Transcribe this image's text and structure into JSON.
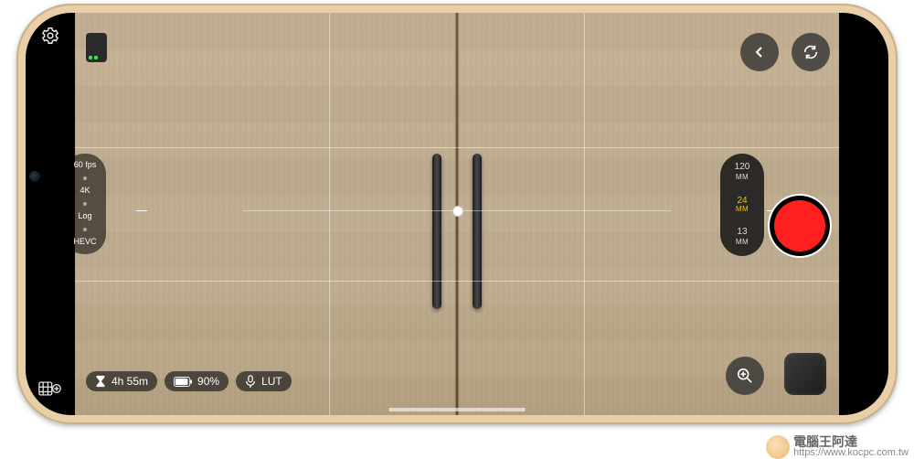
{
  "settings_pill": {
    "fps": "60 fps",
    "resolution": "4K",
    "profile": "Log",
    "codec": "HEVC"
  },
  "bottom_chips": {
    "time_remaining": "4h 55m",
    "battery": "90%",
    "lut": "LUT"
  },
  "focal_lengths": [
    {
      "value": "120",
      "unit": "MM",
      "active": false
    },
    {
      "value": "24",
      "unit": "MM",
      "active": true
    },
    {
      "value": "13",
      "unit": "MM",
      "active": false
    }
  ],
  "icons": {
    "gear": "gear-icon",
    "grid_mode": "grid-add-icon",
    "back": "chevron-left-icon",
    "switch_camera": "cycle-icon",
    "zoom": "magnify-plus-icon",
    "hourglass": "hourglass-icon",
    "battery": "battery-icon",
    "mic": "mic-icon"
  },
  "watermark": {
    "title": "電腦王阿達",
    "url": "https://www.kocpc.com.tw"
  }
}
